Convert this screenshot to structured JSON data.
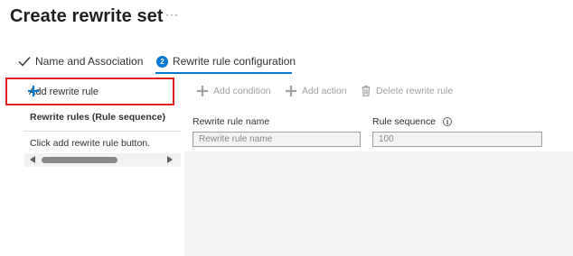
{
  "header": {
    "title": "Create rewrite set",
    "more_label": "···"
  },
  "tabs": [
    {
      "label": "Name and Association",
      "state": "completed"
    },
    {
      "label": "Rewrite rule configuration",
      "step": "2",
      "state": "active"
    }
  ],
  "left_pane": {
    "add_rule_label": "Add rewrite rule",
    "rules_header": "Rewrite rules (Rule sequence)",
    "empty_message": "Click add rewrite rule button."
  },
  "toolbar": {
    "add_condition_label": "Add condition",
    "add_action_label": "Add action",
    "delete_rule_label": "Delete rewrite rule"
  },
  "form": {
    "rule_name_label": "Rewrite rule name",
    "rule_name_placeholder": "Rewrite rule name",
    "rule_sequence_label": "Rule sequence",
    "rule_sequence_placeholder": "100"
  },
  "colors": {
    "accent": "#0078d4",
    "highlight_border": "#e0201e",
    "disabled_text": "#a19f9d",
    "pane_background": "#f3f2f1"
  }
}
